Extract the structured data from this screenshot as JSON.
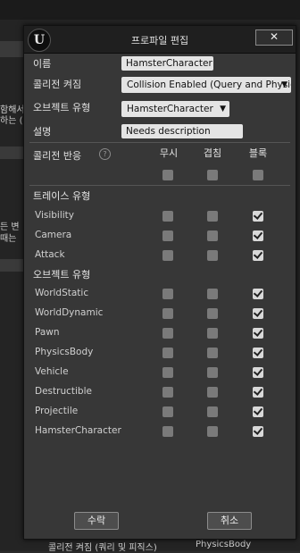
{
  "background": {
    "text_lines_top": [
      "함해서",
      "하는 ("
    ],
    "text_lines_mid": [
      "든 변",
      "때는"
    ],
    "footer_left": "콜리전 켜짐 (쿼리 및 피직스)",
    "footer_right": "PhysicsBody"
  },
  "dialog": {
    "title": "프로파일 편집",
    "close_label": "✕",
    "fields": {
      "name_label": "이름",
      "name_value": "HamsterCharacter",
      "collision_label": "콜리전 켜짐",
      "collision_value": "Collision Enabled (Query and Physics)",
      "object_type_label": "오브젝트 유형",
      "object_type_value": "HamsterCharacter",
      "description_label": "설명",
      "description_value": "Needs description"
    },
    "response_header": {
      "label": "콜리전 반응",
      "help_icon": "?",
      "col_ignore": "무시",
      "col_overlap": "겹침",
      "col_block": "블록"
    },
    "trace_section_title": "트레이스 유형",
    "trace_rows": [
      {
        "label": "Visibility",
        "ignore": false,
        "overlap": false,
        "block": true
      },
      {
        "label": "Camera",
        "ignore": false,
        "overlap": false,
        "block": true
      },
      {
        "label": "Attack",
        "ignore": false,
        "overlap": false,
        "block": true
      }
    ],
    "object_section_title": "오브젝트 유형",
    "object_rows": [
      {
        "label": "WorldStatic",
        "ignore": false,
        "overlap": false,
        "block": true
      },
      {
        "label": "WorldDynamic",
        "ignore": false,
        "overlap": false,
        "block": true
      },
      {
        "label": "Pawn",
        "ignore": false,
        "overlap": false,
        "block": true
      },
      {
        "label": "PhysicsBody",
        "ignore": false,
        "overlap": false,
        "block": true
      },
      {
        "label": "Vehicle",
        "ignore": false,
        "overlap": false,
        "block": true
      },
      {
        "label": "Destructible",
        "ignore": false,
        "overlap": false,
        "block": true
      },
      {
        "label": "Projectile",
        "ignore": false,
        "overlap": false,
        "block": true
      },
      {
        "label": "HamsterCharacter",
        "ignore": false,
        "overlap": false,
        "block": true
      }
    ],
    "accept_label": "수락",
    "cancel_label": "취소"
  },
  "icons": {
    "dropdown_arrow": "▼",
    "logo": "U"
  }
}
